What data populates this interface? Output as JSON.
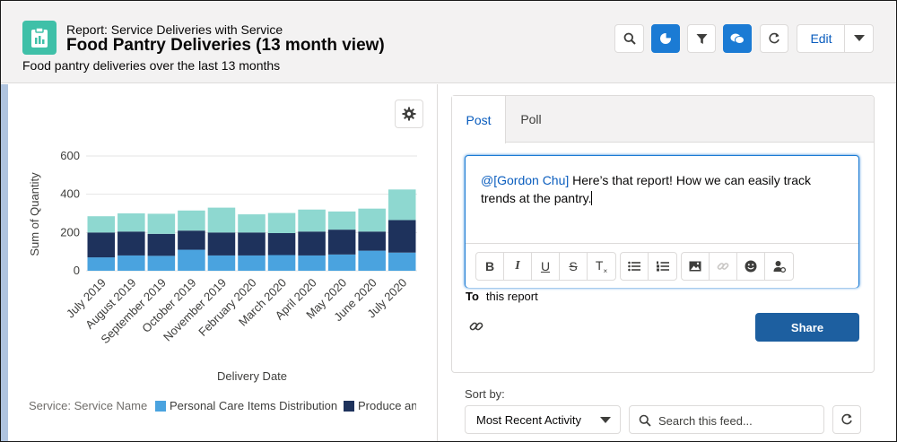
{
  "header": {
    "eyebrow": "Report: Service Deliveries with Service",
    "title": "Food Pantry Deliveries (13 month view)",
    "description": "Food pantry deliveries over the last 13 months",
    "icon": "report-clipboard-icon",
    "icon_color": "#3fc0a8",
    "actions": {
      "search_icon": "search-icon",
      "chart_icon": "pie-chart-icon",
      "filter_icon": "filter-icon",
      "chatter_icon": "chat-bubbles-icon",
      "refresh_icon": "refresh-icon",
      "edit_label": "Edit",
      "menu_icon": "chevron-down-icon"
    }
  },
  "chart_data": {
    "type": "bar",
    "stacked": true,
    "categories": [
      "July 2019",
      "August 2019",
      "September 2019",
      "October 2019",
      "November 2019",
      "February 2020",
      "March 2020",
      "April 2020",
      "May 2020",
      "June 2020",
      "July 2020"
    ],
    "series": [
      {
        "name": "Personal Care Items Distribution",
        "color": "#4aa3df",
        "values": [
          70,
          80,
          78,
          110,
          80,
          80,
          82,
          80,
          85,
          105,
          95
        ]
      },
      {
        "name": "Produce and",
        "color": "#1e325c",
        "values": [
          130,
          125,
          115,
          100,
          120,
          120,
          115,
          125,
          130,
          100,
          170
        ]
      },
      {
        "name": "",
        "color": "#8ed8d0",
        "values": [
          85,
          95,
          105,
          105,
          130,
          95,
          105,
          115,
          95,
          120,
          160
        ]
      }
    ],
    "ylabel": "Sum of Quantity",
    "xlabel": "Delivery Date",
    "ylim": [
      0,
      600
    ],
    "yticks": [
      0,
      200,
      400,
      600
    ],
    "grid": true,
    "legend_title": "Service: Service Name",
    "legend_position": "bottom"
  },
  "chart_settings_icon": "gear-icon",
  "publisher": {
    "tabs": [
      {
        "label": "Post",
        "active": true
      },
      {
        "label": "Poll",
        "active": false
      }
    ],
    "mention": "@[Gordon Chu]",
    "body": " Here’s that report! How we can easily track trends at the pantry.",
    "toolbar": [
      "bold-icon",
      "italic-icon",
      "underline-icon",
      "strikethrough-icon",
      "clear-format-icon",
      "bullet-list-icon",
      "numbered-list-icon",
      "image-icon",
      "link-icon",
      "emoji-icon",
      "mention-user-icon"
    ],
    "to_label": "To",
    "to_value": "this report",
    "attach_icon": "paperclip-icon",
    "share_label": "Share",
    "share_color": "#1d5fa0"
  },
  "feed": {
    "sort_label": "Sort by:",
    "sort_value": "Most Recent Activity",
    "search_placeholder": "Search this feed...",
    "refresh_icon": "refresh-icon"
  }
}
